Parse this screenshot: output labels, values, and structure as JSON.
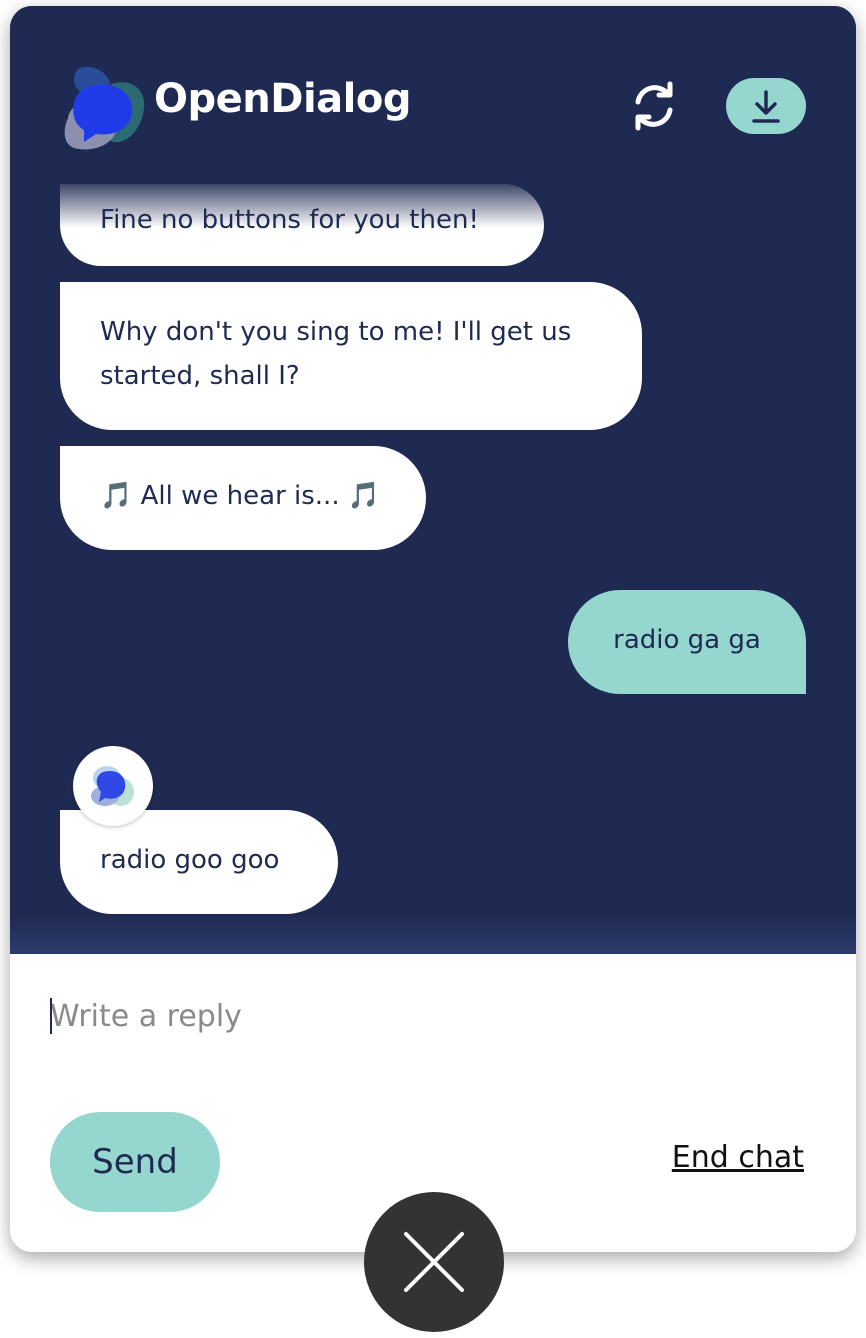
{
  "header": {
    "brand_name": "OpenDialog",
    "refresh_icon": "refresh-icon",
    "download_icon": "download-icon"
  },
  "messages": [
    {
      "sender": "bot",
      "text": "Fine no buttons for you then!"
    },
    {
      "sender": "bot",
      "text": "Why don't you sing to me! I'll get us started, shall I?"
    },
    {
      "sender": "bot",
      "text": "🎵 All we hear is... 🎵"
    },
    {
      "sender": "user",
      "text": "radio ga ga"
    },
    {
      "sender": "bot",
      "text": "radio goo goo"
    }
  ],
  "composer": {
    "placeholder": "Write a reply",
    "value": "",
    "send_label": "Send",
    "end_chat_label": "End chat"
  },
  "close_icon": "close-icon",
  "colors": {
    "chat_background": "#1f2a52",
    "accent": "#95d7ce",
    "bot_bubble": "#ffffff",
    "close_button": "#333333"
  }
}
